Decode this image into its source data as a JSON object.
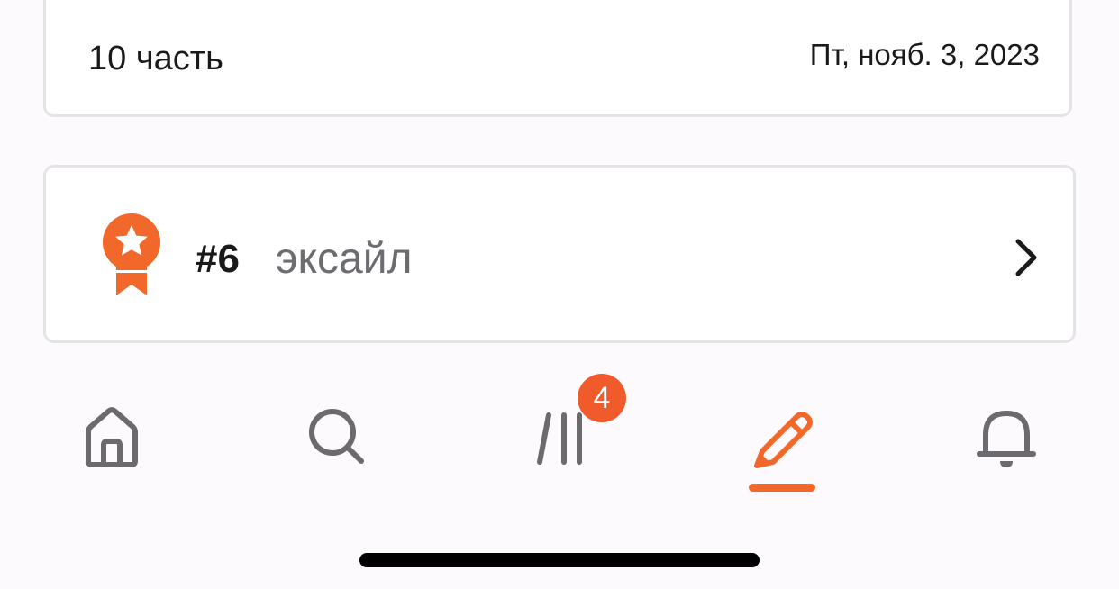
{
  "chapter": {
    "title": "10 часть",
    "date": "Пт, нояб. 3, 2023"
  },
  "ranking": {
    "number": "#6",
    "tag": "эксайл",
    "icon": "award-ribbon-icon",
    "chevron_icon": "chevron-right-icon"
  },
  "bottom_nav": {
    "items": [
      {
        "name": "home",
        "icon": "home-icon",
        "active": false
      },
      {
        "name": "search",
        "icon": "search-icon",
        "active": false
      },
      {
        "name": "library",
        "icon": "library-icon",
        "active": false,
        "badge": "4"
      },
      {
        "name": "write",
        "icon": "pencil-icon",
        "active": true
      },
      {
        "name": "notifications",
        "icon": "bell-icon",
        "active": false
      }
    ],
    "library_badge": "4"
  },
  "colors": {
    "accent": "#f2682b",
    "badge": "#f15a2b",
    "icon_gray": "#6b6a6e",
    "text_primary": "#1a1a1a",
    "text_secondary": "#6e6c70",
    "card_border": "#e4e4e6",
    "background": "#fcfafc"
  }
}
